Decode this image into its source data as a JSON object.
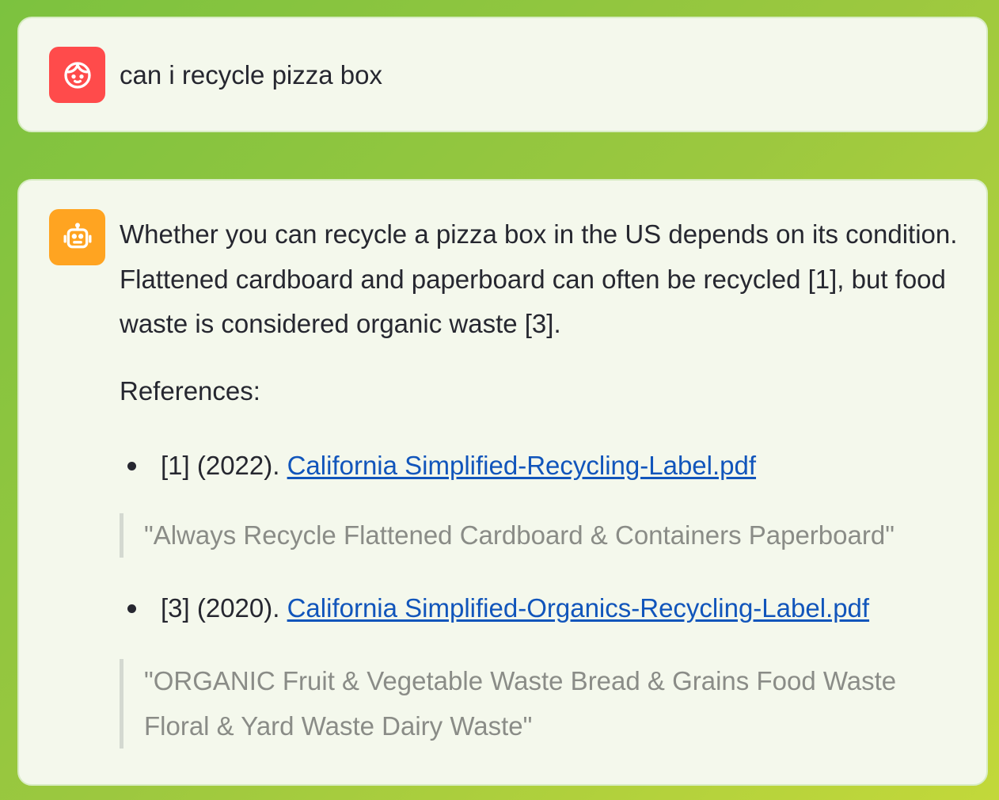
{
  "user_message": {
    "avatar_icon": "user-face-icon",
    "avatar_color": "#ff4b4b",
    "text": "can i recycle pizza box"
  },
  "assistant_message": {
    "avatar_icon": "robot-icon",
    "avatar_color": "#ffa421",
    "answer": "Whether you can recycle a pizza box in the US depends on its condition. Flattened cardboard and paperboard can often be recycled [1], but food waste is considered organic waste [3].",
    "references_heading": "References:",
    "references": [
      {
        "prefix": "[1] (2022). ",
        "link_text": "California Simplified-Recycling-Label.pdf",
        "quote": "\"Always Recycle Flattened Cardboard & Containers Paperboard\""
      },
      {
        "prefix": "[3] (2020). ",
        "link_text": "California Simplified-Organics-Recycling-Label.pdf",
        "quote": "\"ORGANIC Fruit & Vegetable Waste Bread & Grains Food Waste Floral & Yard Waste Dairy Waste\""
      }
    ]
  },
  "colors": {
    "background_start": "#7cc23f",
    "background_end": "#c2d83a",
    "card": "#f4f8ec",
    "link": "#1155bb",
    "quote_text": "#8a8c87"
  }
}
